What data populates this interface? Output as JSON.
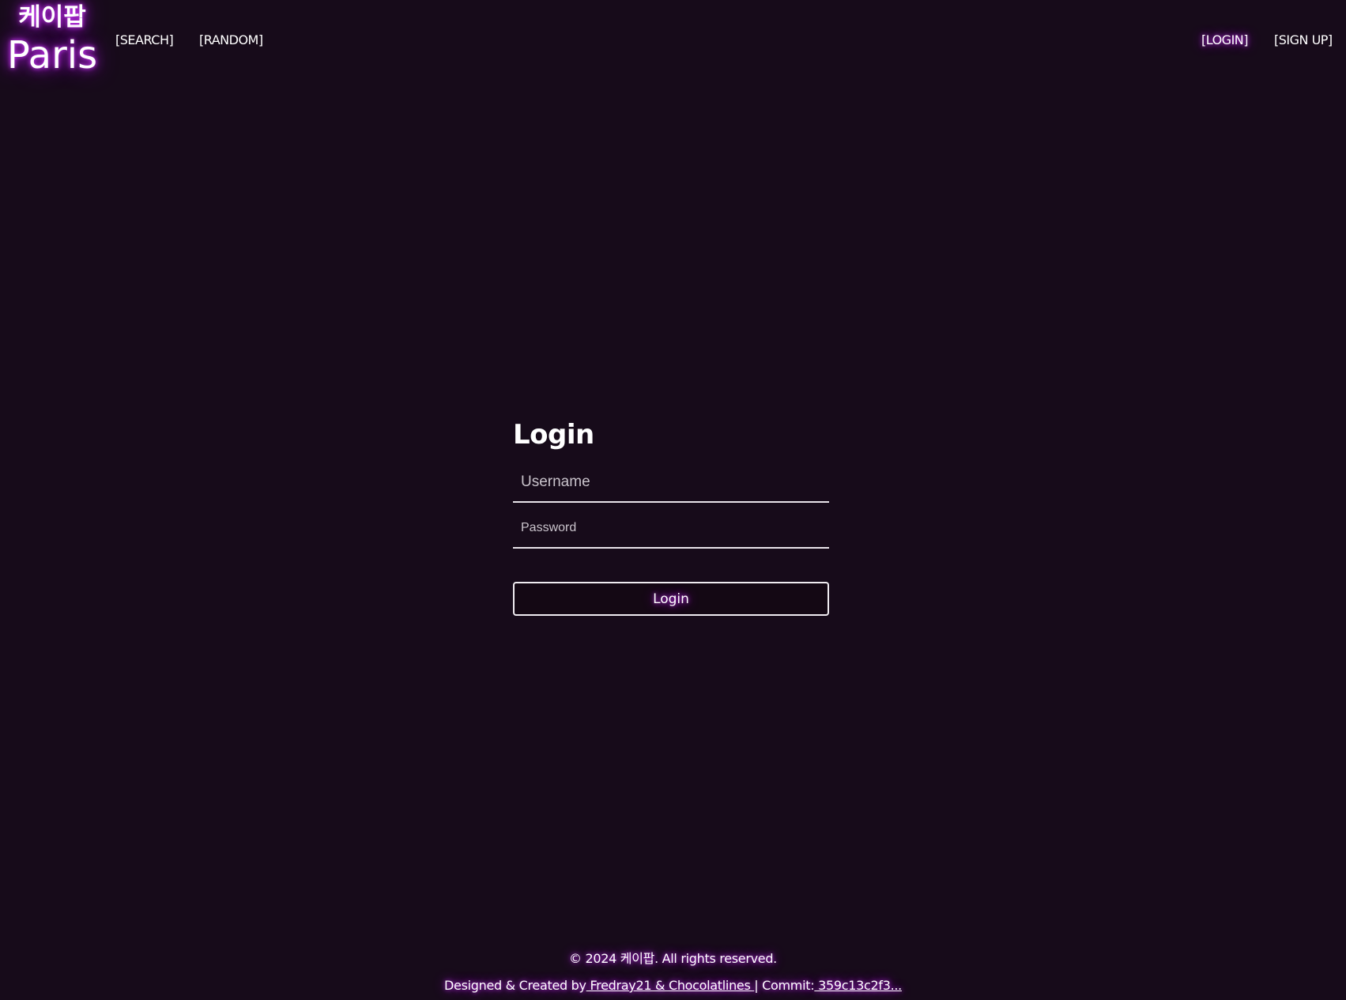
{
  "header": {
    "logo_korean": "케이팝",
    "logo_paris": "Paris",
    "nav_left": [
      "[SEARCH]",
      "[RANDOM]"
    ],
    "nav_right": [
      "[LOGIN]",
      "[SIGN UP]"
    ]
  },
  "login": {
    "title": "Login",
    "username_placeholder": "Username",
    "password_placeholder": "Password",
    "button_label": "Login"
  },
  "footer": {
    "copyright": "© 2024 케이팝. All rights reserved.",
    "designed_prefix": "Designed & Created by",
    "authors_link": " Fredray21 & Chocolatlines ",
    "separator": "| Commit:",
    "commit_link": " 359c13c2f3..."
  },
  "colors": {
    "background": "#170b1a",
    "glow": "#d23cff",
    "text": "#ffffff"
  }
}
